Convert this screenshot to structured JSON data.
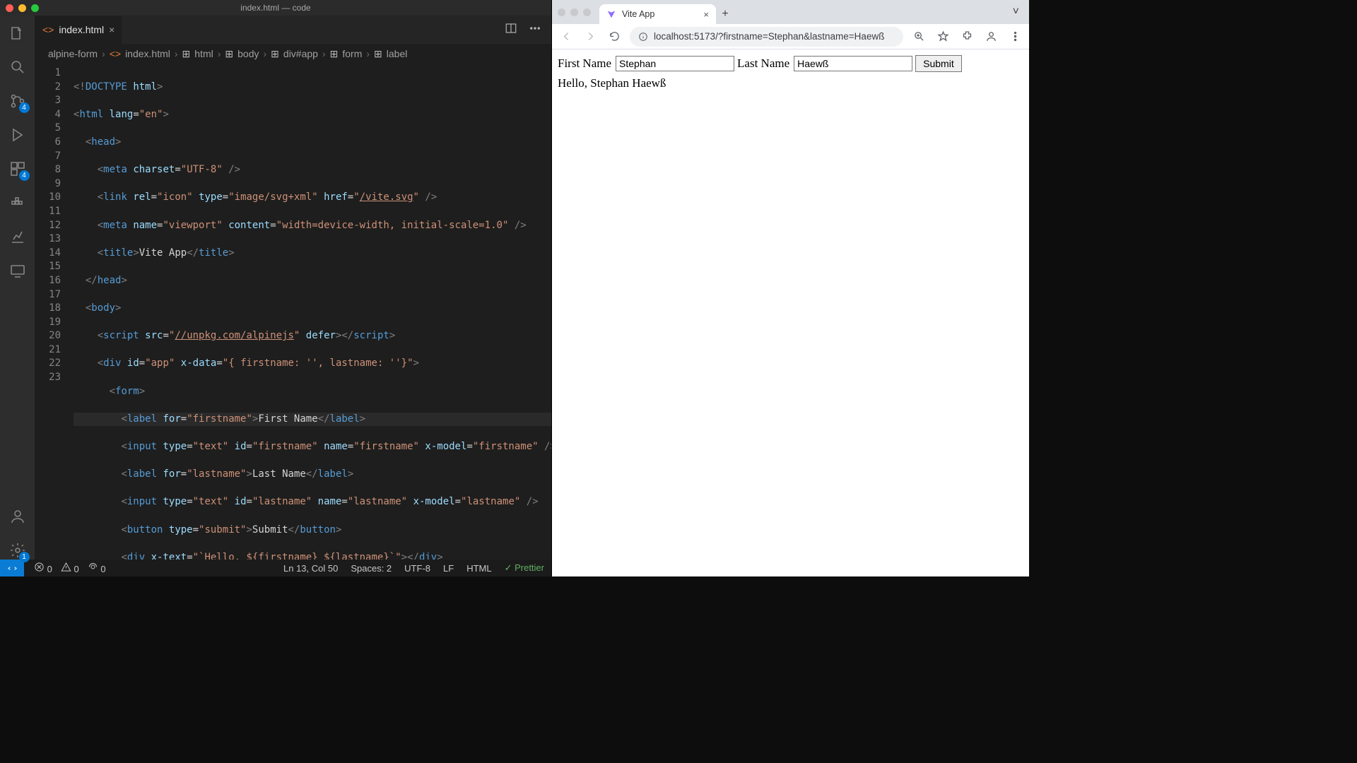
{
  "vscode": {
    "window_title": "index.html — code",
    "tab": {
      "filename": "index.html"
    },
    "breadcrumb": [
      "alpine-form",
      "index.html",
      "html",
      "body",
      "div#app",
      "form",
      "label"
    ],
    "activity_badges": {
      "scm": "4",
      "settings": "1"
    },
    "gutter": [
      "1",
      "2",
      "3",
      "4",
      "5",
      "6",
      "7",
      "8",
      "9",
      "10",
      "11",
      "12",
      "13",
      "14",
      "15",
      "16",
      "17",
      "18",
      "19",
      "20",
      "21",
      "22",
      "23"
    ],
    "status": {
      "errors": "0",
      "warnings": "0",
      "ports": "0",
      "cursor": "Ln 13, Col 50",
      "spaces": "Spaces: 2",
      "encoding": "UTF-8",
      "eol": "LF",
      "lang": "HTML",
      "prettier": "Prettier"
    }
  },
  "browser": {
    "tab_title": "Vite App",
    "url": "localhost:5173/?firstname=Stephan&lastname=Haewß",
    "form": {
      "first_label": "First Name",
      "first_value": "Stephan",
      "last_label": "Last Name",
      "last_value": "Haewß",
      "submit": "Submit",
      "greeting": "Hello, Stephan Haewß"
    }
  }
}
